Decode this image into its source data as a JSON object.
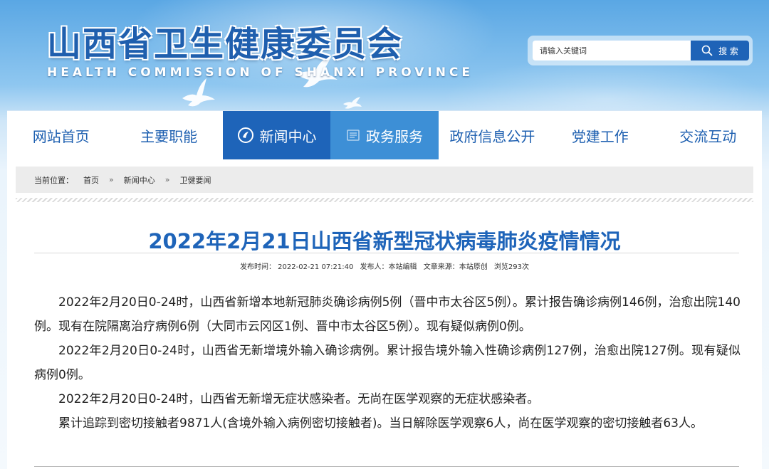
{
  "header": {
    "title_cn": "山西省卫生健康委员会",
    "title_en": "HEALTH COMMISSION OF SHANXI PROVINCE",
    "search": {
      "placeholder": "请输入关键词",
      "button_label": "搜 索"
    }
  },
  "nav": {
    "items": [
      {
        "label": "网站首页"
      },
      {
        "label": "主要职能"
      },
      {
        "label": "新闻中心"
      },
      {
        "label": "政务服务"
      },
      {
        "label": "政府信息公开"
      },
      {
        "label": "党建工作"
      },
      {
        "label": "交流互动"
      }
    ]
  },
  "breadcrumb": {
    "prefix": "当前位置：",
    "items": [
      "首页",
      "新闻中心",
      "卫健要闻"
    ],
    "separator": "»"
  },
  "article": {
    "title": "2022年2月21日山西省新型冠状病毒肺炎疫情情况",
    "meta": {
      "publish_time": "发布时间： 2022-02-21 07:21:40",
      "publisher": "发布人：本站编辑",
      "source": "文章来源：本站原创",
      "views": "浏览293次"
    },
    "paragraphs": [
      "2022年2月20日0-24时，山西省新增本地新冠肺炎确诊病例5例（晋中市太谷区5例）。累计报告确诊病例146例，治愈出院140例。现有在院隔离治疗病例6例（大同市云冈区1例、晋中市太谷区5例）。现有疑似病例0例。",
      "2022年2月20日0-24时，山西省无新增境外输入确诊病例。累计报告境外输入性确诊病例127例，治愈出院127例。现有疑似病例0例。",
      "2022年2月20日0-24时，山西省无新增无症状感染者。无尚在医学观察的无症状感染者。",
      "累计追踪到密切接触者9871人(含境外输入病例密切接触者)。当日解除医学观察6人，尚在医学观察的密切接触者63人。"
    ]
  },
  "colors": {
    "brand_blue": "#1e64b9",
    "nav_active_light": "#3d8fd6",
    "sky_blue": "#5aa7e4"
  }
}
